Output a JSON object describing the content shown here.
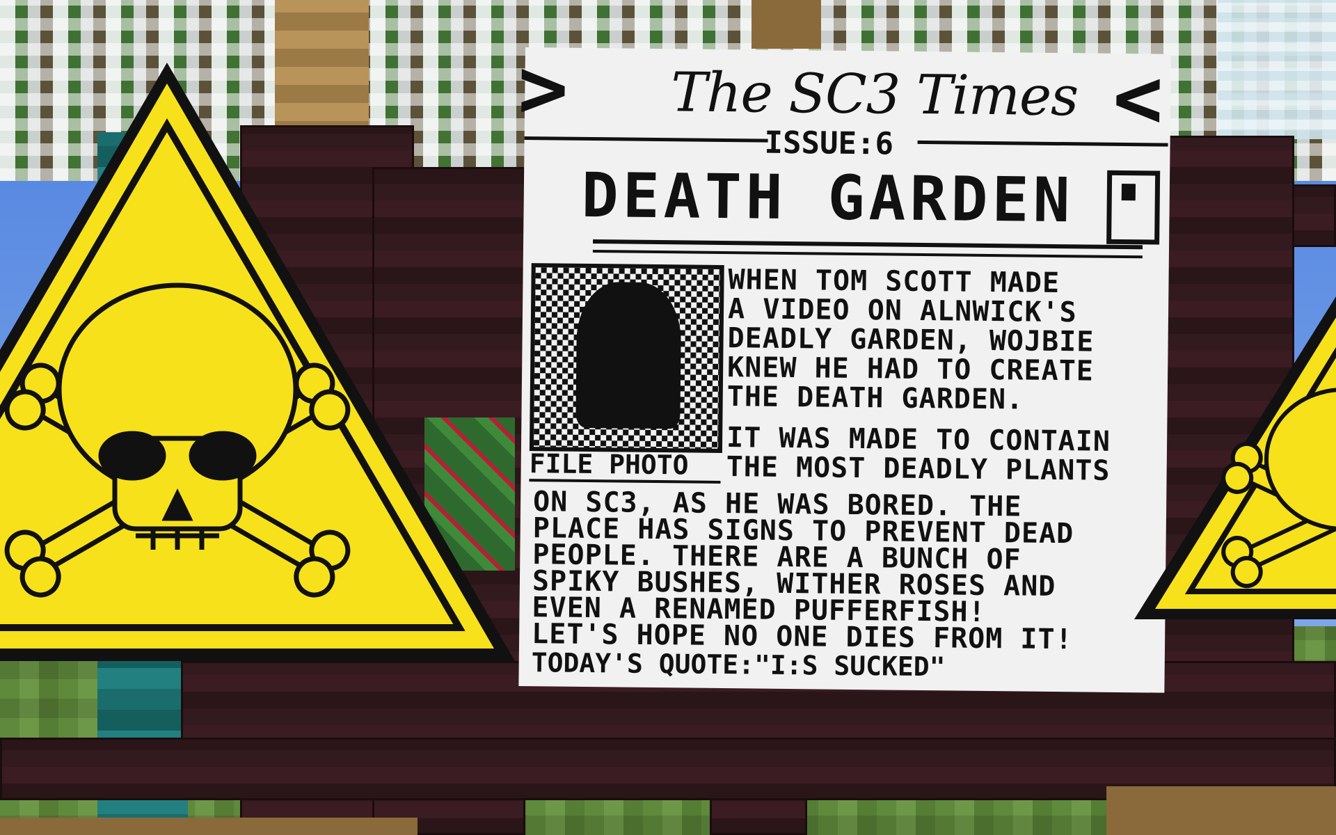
{
  "scene": {
    "description_tag": "minecraft-death-garden",
    "sign_color": "#f7e11a",
    "paper_color": "#f1f1f1"
  },
  "newspaper": {
    "masthead": "The SC3 Times",
    "issue": "ISSUE:6",
    "headline": "DEATH GARDEN",
    "photo_caption": "FILE PHOTO",
    "paragraph1_lines": [
      "WHEN TOM SCOTT MADE",
      "A VIDEO ON ALNWICK'S",
      "DEADLY GARDEN, WOJBIE",
      "KNEW HE HAD TO CREATE",
      "THE DEATH GARDEN."
    ],
    "paragraph2_lines_right": [
      "IT WAS MADE TO CONTAIN",
      "THE MOST DEADLY PLANTS"
    ],
    "paragraph2_lines_full": [
      "ON SC3, AS HE WAS BORED. THE",
      "PLACE HAS SIGNS TO PREVENT DEAD",
      "PEOPLE. THERE ARE A BUNCH OF",
      "SPIKY BUSHES, WITHER ROSES AND",
      "EVEN A RENAMED PUFFERFISH!",
      "LET'S HOPE NO ONE DIES FROM IT!"
    ],
    "quote": "TODAY'S QUOTE:\"I:S SUCKED\""
  },
  "icons": {
    "left_sign": "skull-crossbones-icon",
    "right_sign": "skull-crossbones-icon"
  }
}
